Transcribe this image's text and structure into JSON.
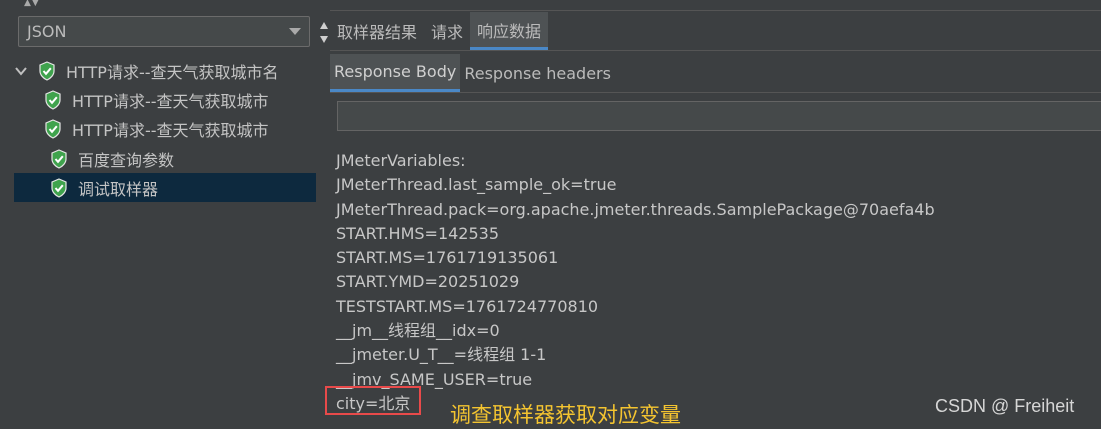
{
  "left_panel": {
    "renderer_select": {
      "value": "JSON"
    },
    "tree": [
      {
        "label": "HTTP请求--查天气获取城市名",
        "expanded": true,
        "status": "success"
      },
      {
        "label": "HTTP请求--查天气获取城市",
        "status": "success"
      },
      {
        "label": "HTTP请求--查天气获取城市",
        "status": "success"
      },
      {
        "label": "百度查询参数",
        "status": "success"
      },
      {
        "label": "调试取样器",
        "status": "success",
        "selected": true
      }
    ]
  },
  "right_panel": {
    "tabs": [
      "取样器结果",
      "请求",
      "响应数据"
    ],
    "active_tab": "响应数据",
    "sub_tabs": [
      "Response Body",
      "Response headers"
    ],
    "active_sub_tab": "Response Body",
    "search_value": "",
    "body_lines": [
      "JMeterVariables:",
      "JMeterThread.last_sample_ok=true",
      "JMeterThread.pack=org.apache.jmeter.threads.SamplePackage@70aefa4b",
      "START.HMS=142535",
      "START.MS=1761719135061",
      "START.YMD=20251029",
      "TESTSTART.MS=1761724770810",
      "__jm__线程组__idx=0",
      "__jmeter.U_T__=线程组 1-1",
      "__jmv_SAME_USER=true",
      "city=北京"
    ]
  },
  "annotation": "调查取样器获取对应变量",
  "watermark": "CSDN @ Freiheit",
  "colors": {
    "success_icon": "#3fa34d",
    "accent": "#4a88c7",
    "highlight_border": "#e84a4a",
    "annotation_text": "#f4c430"
  }
}
